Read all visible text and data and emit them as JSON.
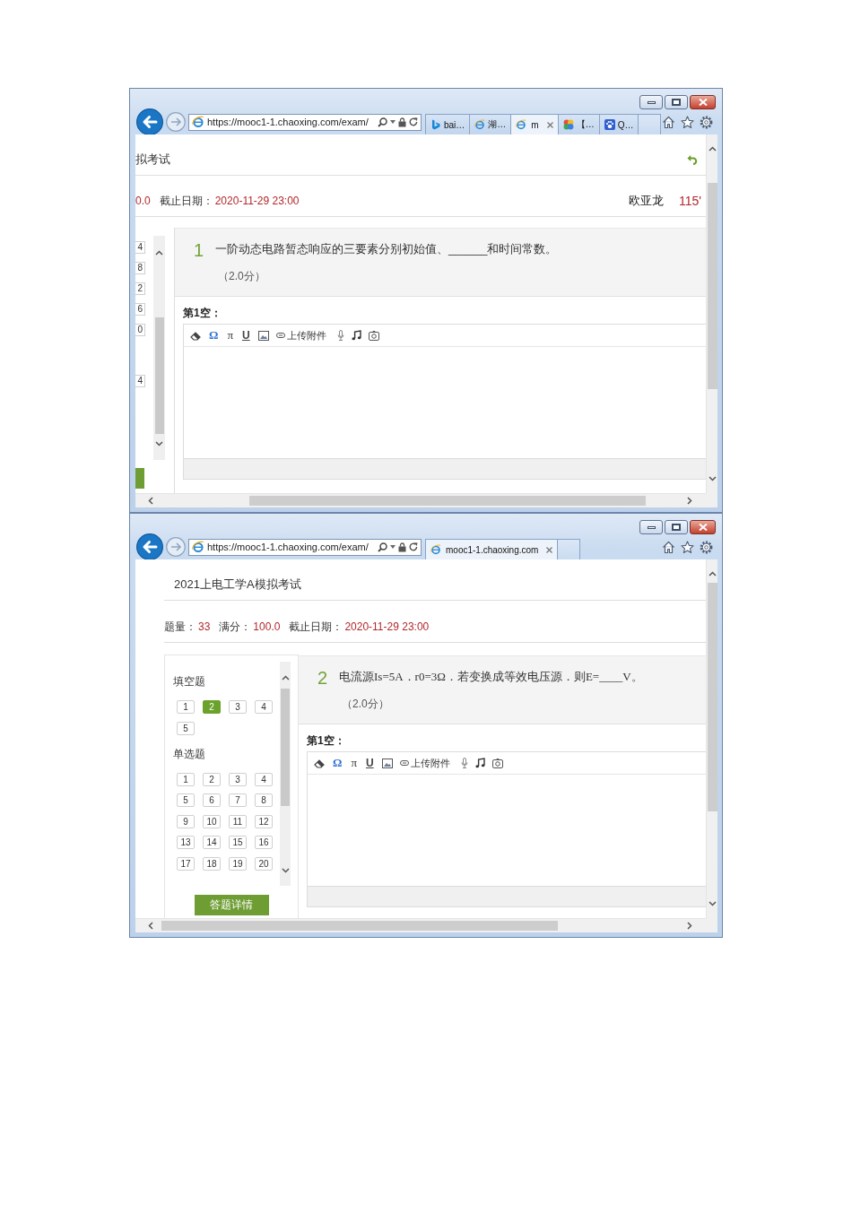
{
  "windows": [
    {
      "address": "https://mooc1-1.chaoxing.com/exam/",
      "tabs": [
        {
          "kind": "letter",
          "label": "bai…",
          "selected": false
        },
        {
          "kind": "globe",
          "label": "湖…",
          "selected": false
        },
        {
          "kind": "globe",
          "label": "m",
          "selected": true
        },
        {
          "kind": "petals",
          "label": "【…",
          "selected": false
        },
        {
          "kind": "paw",
          "label": "Q…",
          "selected": false
        }
      ],
      "page": {
        "kind": "shifted",
        "heading": "拟考试",
        "info": [
          {
            "text": "0.0",
            "highlight": true
          },
          {
            "text": "截止日期：",
            "highlight": false
          },
          {
            "text": "2020-11-29 23:00",
            "highlight": true
          }
        ],
        "user": "欧亚龙",
        "timer": "115'",
        "sections": [
          {
            "items": [
              {
                "label": "4",
                "selected": false
              },
              {
                "label": "8",
                "selected": false
              },
              {
                "label": "2",
                "selected": false
              },
              {
                "label": "6",
                "selected": false
              },
              {
                "label": "0",
                "selected": false
              }
            ]
          },
          {
            "items": [
              {
                "label": "4",
                "selected": false
              }
            ]
          }
        ],
        "question": {
          "number": "1",
          "text": "一阶动态电路暂态响应的三要素分别初始值、______和时间常数。",
          "score": "（2.0分）"
        },
        "blank_label": "第1空：",
        "toolbar": {
          "symbols": [
            {
              "kind": "symbol",
              "label": "Ω"
            },
            {
              "kind": "math",
              "label": "π"
            },
            {
              "kind": "underline",
              "label": "U"
            }
          ],
          "upload": "上传附件"
        }
      }
    },
    {
      "address": "https://mooc1-1.chaoxing.com/exam/",
      "tabs": [
        {
          "kind": "globe",
          "label": "mooc1-1.chaoxing.com",
          "selected": true
        }
      ],
      "page": {
        "kind": "full",
        "heading": "2021上电工学A模拟考试",
        "info": [
          {
            "text": "题量：",
            "highlight": false
          },
          {
            "text": "33",
            "highlight": true
          },
          {
            "text": "满分：",
            "highlight": false
          },
          {
            "text": "100.0",
            "highlight": true
          },
          {
            "text": "截止日期：",
            "highlight": false
          },
          {
            "text": "2020-11-29 23:00",
            "highlight": true
          }
        ],
        "sections": [
          {
            "title": "填空题",
            "items": [
              {
                "label": "1",
                "selected": false
              },
              {
                "label": "2",
                "selected": true
              },
              {
                "label": "3",
                "selected": false
              },
              {
                "label": "4",
                "selected": false
              },
              {
                "label": "5",
                "selected": false
              }
            ]
          },
          {
            "title": "单选题",
            "items": [
              {
                "label": "1",
                "selected": false
              },
              {
                "label": "2",
                "selected": false
              },
              {
                "label": "3",
                "selected": false
              },
              {
                "label": "4",
                "selected": false
              },
              {
                "label": "5",
                "selected": false
              },
              {
                "label": "6",
                "selected": false
              },
              {
                "label": "7",
                "selected": false
              },
              {
                "label": "8",
                "selected": false
              },
              {
                "label": "9",
                "selected": false
              },
              {
                "label": "10",
                "selected": false
              },
              {
                "label": "11",
                "selected": false
              },
              {
                "label": "12",
                "selected": false
              },
              {
                "label": "13",
                "selected": false
              },
              {
                "label": "14",
                "selected": false
              },
              {
                "label": "15",
                "selected": false
              },
              {
                "label": "16",
                "selected": false
              },
              {
                "label": "17",
                "selected": false
              },
              {
                "label": "18",
                "selected": false
              },
              {
                "label": "19",
                "selected": false
              },
              {
                "label": "20",
                "selected": false
              }
            ]
          }
        ],
        "details_button": "答题详情",
        "question": {
          "number": "2",
          "text": "电流源Is=5A．r0=3Ω．若变换成等效电压源．则E=____V。",
          "score": "（2.0分）"
        },
        "blank_label": "第1空：",
        "toolbar": {
          "symbols": [
            {
              "kind": "symbol",
              "label": "Ω"
            },
            {
              "kind": "math",
              "label": "π"
            },
            {
              "kind": "underline",
              "label": "U"
            }
          ],
          "upload": "上传附件"
        }
      }
    }
  ]
}
